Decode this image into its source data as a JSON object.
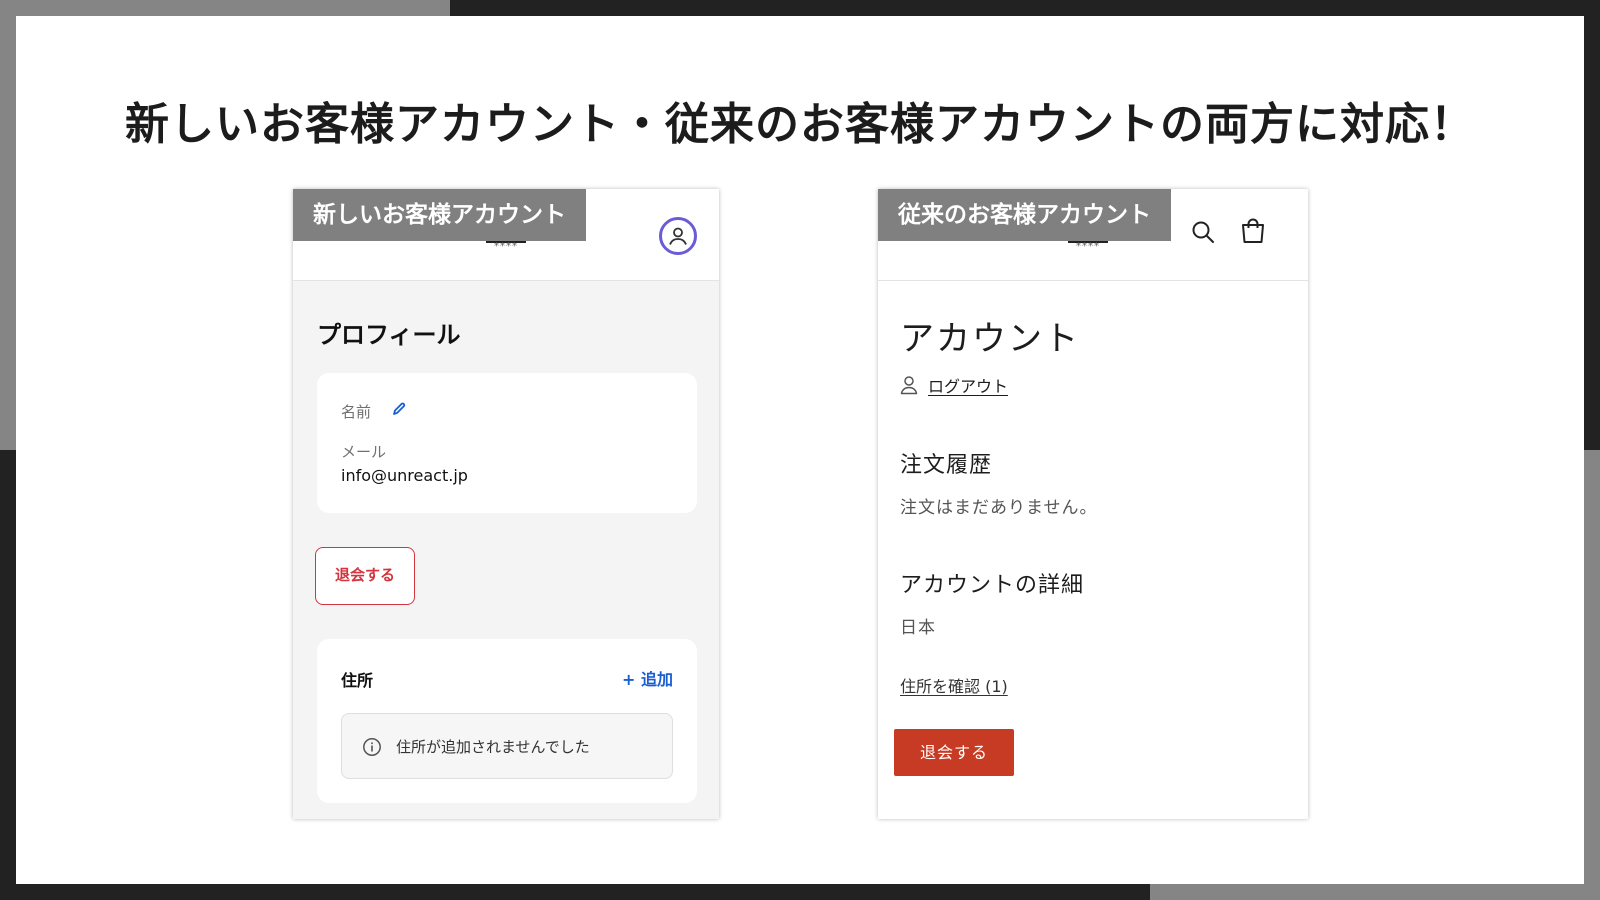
{
  "headline": "新しいお客様アカウント・従来のお客様アカウントの両方に対応！",
  "new_account": {
    "label": "新しいお客様アカウント",
    "logo_text": "****",
    "profile_title": "プロフィール",
    "name_label": "名前",
    "email_label": "メール",
    "email_value": "info@unreact.jp",
    "delete_button": "退会する",
    "address_title": "住所",
    "address_add": "+ 追加",
    "address_empty": "住所が追加されませんでした",
    "accent_color": "#1a5fd0",
    "danger_color": "#d4343e"
  },
  "classic_account": {
    "label": "従来のお客様アカウント",
    "logo_text": "****",
    "title": "アカウント",
    "logout": "ログアウト",
    "order_history_title": "注文履歴",
    "order_history_text": "注文はまだありません。",
    "details_title": "アカウントの詳細",
    "details_country": "日本",
    "confirm_address": "住所を確認 (1)",
    "delete_button": "退会する",
    "button_color": "#c73b24"
  },
  "icons": {
    "new_account": [
      "account-circle-icon",
      "pencil-icon",
      "info-icon"
    ],
    "classic_account": [
      "search-icon",
      "cart-icon",
      "person-icon"
    ]
  }
}
